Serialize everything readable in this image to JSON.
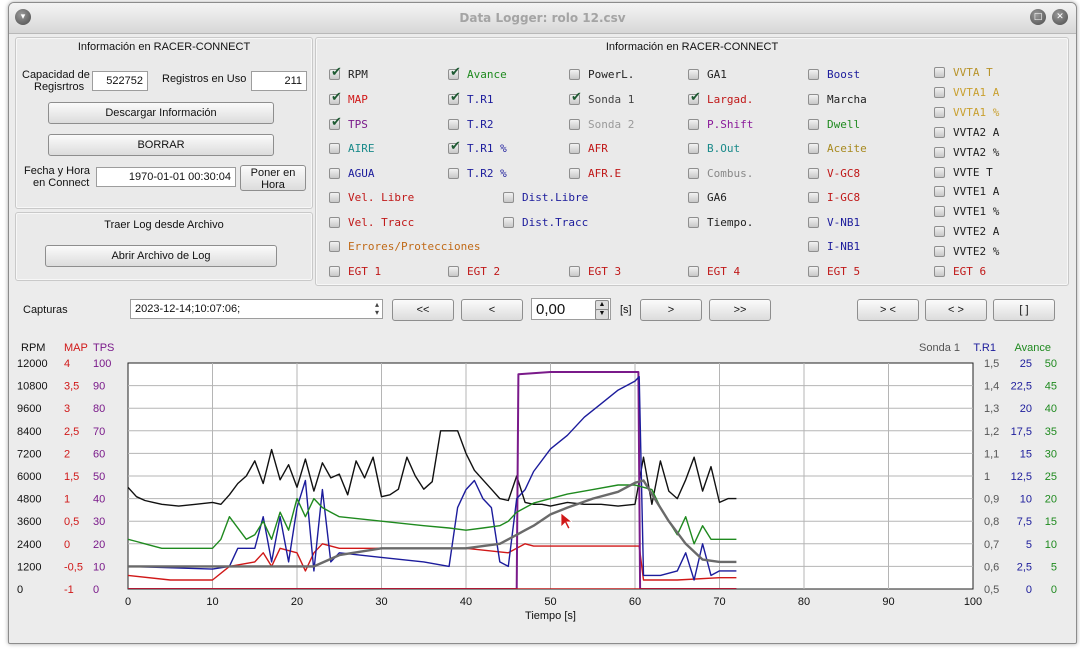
{
  "window": {
    "title": "Data Logger: rolo 12.csv"
  },
  "left_info": {
    "title": "Información en RACER-CONNECT",
    "capacity_label_1": "Capacidad de",
    "capacity_label_2": "Regisrtros",
    "capacity_value": "522752",
    "used_label": "Registros en Uso",
    "used_value": "211",
    "download_label": "Descargar Información",
    "erase_label": "BORRAR",
    "datetime_label_1": "Fecha y Hora",
    "datetime_label_2": "en Connect",
    "datetime_value": "1970-01-01 00:30:04",
    "set_time_label_1": "Poner en",
    "set_time_label_2": "Hora"
  },
  "file_group": {
    "title": "Traer Log desde Archivo",
    "open_label": "Abrir Archivo de Log"
  },
  "channels": {
    "title": "Información en RACER-CONNECT",
    "items": [
      {
        "label": "RPM",
        "checked": true,
        "color": "#222222"
      },
      {
        "label": "Avance",
        "checked": true,
        "color": "#1f8a1f"
      },
      {
        "label": "PowerL.",
        "checked": false,
        "color": "#222222"
      },
      {
        "label": "GA1",
        "checked": false,
        "color": "#222222"
      },
      {
        "label": "Boost",
        "checked": false,
        "color": "#1c1c9c"
      },
      {
        "label": "VVTA   T",
        "checked": false,
        "color": "#b8932a"
      },
      {
        "label": "MAP",
        "checked": true,
        "color": "#d01818"
      },
      {
        "label": "T.R1",
        "checked": true,
        "color": "#1c1c9c"
      },
      {
        "label": "Sonda 1",
        "checked": true,
        "color": "#444444"
      },
      {
        "label": "Largad.",
        "checked": true,
        "color": "#c01818"
      },
      {
        "label": "Marcha",
        "checked": false,
        "color": "#222222"
      },
      {
        "label": "VVTA1 A",
        "checked": false,
        "color": "#c9a030"
      },
      {
        "label": "TPS",
        "checked": true,
        "color": "#7a1a8a"
      },
      {
        "label": "T.R2",
        "checked": false,
        "color": "#1c1c9c"
      },
      {
        "label": "Sonda 2",
        "checked": false,
        "color": "#9a9a9a"
      },
      {
        "label": "P.Shift",
        "checked": false,
        "color": "#8a1a9a"
      },
      {
        "label": "Dwell",
        "checked": false,
        "color": "#1f8a1f"
      },
      {
        "label": "VVTA1 %",
        "checked": false,
        "color": "#c9a030"
      },
      {
        "label": "AIRE",
        "checked": false,
        "color": "#1a8a8a"
      },
      {
        "label": "T.R1 %",
        "checked": true,
        "color": "#1c1c9c"
      },
      {
        "label": "AFR",
        "checked": false,
        "color": "#c01818"
      },
      {
        "label": "B.Out",
        "checked": false,
        "color": "#1a8a8a"
      },
      {
        "label": "Aceite",
        "checked": false,
        "color": "#a88a20"
      },
      {
        "label": "VVTA2 A",
        "checked": false,
        "color": "#222222"
      },
      {
        "label": "AGUA",
        "checked": false,
        "color": "#1c1c9c"
      },
      {
        "label": "T.R2 %",
        "checked": false,
        "color": "#1c1c9c"
      },
      {
        "label": "AFR.E",
        "checked": false,
        "color": "#c01818"
      },
      {
        "label": "Combus.",
        "checked": false,
        "color": "#888888"
      },
      {
        "label": "V-GC8",
        "checked": false,
        "color": "#c01818"
      },
      {
        "label": "VVTA2 %",
        "checked": false,
        "color": "#222222"
      },
      {
        "label": "Vel. Libre",
        "checked": false,
        "color": "#c01818"
      },
      {
        "label": "Dist.Libre",
        "checked": false,
        "color": "#1c1c9c"
      },
      {
        "label": "GA6",
        "checked": false,
        "color": "#222222"
      },
      {
        "label": "I-GC8",
        "checked": false,
        "color": "#c01818"
      },
      {
        "label": "VVTE   T",
        "checked": false,
        "color": "#222222"
      },
      {
        "label": "Vel. Tracc",
        "checked": false,
        "color": "#c01818"
      },
      {
        "label": "Dist.Tracc",
        "checked": false,
        "color": "#1c1c9c"
      },
      {
        "label": "Tiempo.",
        "checked": false,
        "color": "#222222"
      },
      {
        "label": "V-NB1",
        "checked": false,
        "color": "#1c1c9c"
      },
      {
        "label": "VVTE1 A",
        "checked": false,
        "color": "#222222"
      },
      {
        "label": "Errores/Protecciones",
        "checked": false,
        "color": "#c06a18"
      },
      {
        "label": "I-NB1",
        "checked": false,
        "color": "#1c1c9c"
      },
      {
        "label": "VVTE1 %",
        "checked": false,
        "color": "#222222"
      },
      {
        "label": "VVTE2 A",
        "checked": false,
        "color": "#222222"
      },
      {
        "label": "VVTE2 %",
        "checked": false,
        "color": "#222222"
      },
      {
        "label": "EGT 1",
        "checked": false,
        "color": "#c01818"
      },
      {
        "label": "EGT 2",
        "checked": false,
        "color": "#c01818"
      },
      {
        "label": "EGT 3",
        "checked": false,
        "color": "#c01818"
      },
      {
        "label": "EGT 4",
        "checked": false,
        "color": "#c01818"
      },
      {
        "label": "EGT 5",
        "checked": false,
        "color": "#c01818"
      },
      {
        "label": "EGT 6",
        "checked": false,
        "color": "#c01818"
      }
    ]
  },
  "captures": {
    "label": "Capturas",
    "selected": "2023-12-14;10:07:06;",
    "first_label": "<<",
    "prev_label": "<",
    "offset_value": "0,00",
    "unit_label": "[s]",
    "next_label": ">",
    "last_label": ">>",
    "zoom_in_label": "> <",
    "zoom_out_label": "< >",
    "fit_label": "[ ]"
  },
  "chart_data": {
    "type": "line",
    "xlabel": "Tiempo [s]",
    "xlim": [
      0,
      100
    ],
    "x_ticks": [
      "0",
      "10",
      "20",
      "30",
      "40",
      "50",
      "60",
      "70",
      "80",
      "90",
      "100"
    ],
    "left_axes": [
      {
        "name": "RPM",
        "color": "#111111",
        "ticks": [
          "12000",
          "10800",
          "9600",
          "8400",
          "7200",
          "6000",
          "4800",
          "3600",
          "2400",
          "1200",
          "0"
        ]
      },
      {
        "name": "MAP",
        "color": "#d01818",
        "ticks": [
          "4",
          "3,5",
          "3",
          "2,5",
          "2",
          "1,5",
          "1",
          "0,5",
          "0",
          "-0,5",
          "-1"
        ]
      },
      {
        "name": "TPS",
        "color": "#7a1a8a",
        "ticks": [
          "100",
          "90",
          "80",
          "70",
          "60",
          "50",
          "40",
          "30",
          "20",
          "10",
          "0"
        ]
      }
    ],
    "right_axes": [
      {
        "name": "Sonda 1",
        "color": "#555555",
        "ticks": [
          "1,5",
          "1,4",
          "1,3",
          "1,2",
          "1,1",
          "1",
          "0,9",
          "0,8",
          "0,7",
          "0,6",
          "0,5"
        ]
      },
      {
        "name": "T.R1",
        "color": "#1c1c9c",
        "ticks": [
          "25",
          "22,5",
          "20",
          "17,5",
          "15",
          "12,5",
          "10",
          "7,5",
          "5",
          "2,5",
          "0"
        ]
      },
      {
        "name": "Avance",
        "color": "#1f8a1f",
        "ticks": [
          "50",
          "45",
          "40",
          "35",
          "30",
          "25",
          "20",
          "15",
          "10",
          "5",
          "0"
        ]
      }
    ],
    "series": [
      {
        "name": "RPM",
        "color": "#111111",
        "x": [
          0,
          1,
          2,
          3,
          4,
          6,
          8,
          10,
          11,
          12,
          13,
          14,
          15,
          16,
          17,
          18,
          19,
          20,
          21,
          22,
          23,
          24,
          25,
          26,
          27,
          28,
          29,
          30,
          31,
          32,
          33,
          34,
          35,
          36,
          37,
          38,
          39,
          40,
          41,
          42,
          43,
          44,
          45,
          46,
          47,
          48,
          49,
          50,
          52,
          54,
          56,
          58,
          60,
          61,
          62,
          63,
          64,
          65,
          66,
          67,
          68,
          69,
          70,
          71,
          72
        ],
        "y": [
          5400,
          4900,
          4700,
          4600,
          4500,
          4400,
          4500,
          4600,
          4500,
          5000,
          5600,
          6000,
          6800,
          5600,
          7400,
          5800,
          6600,
          5400,
          6900,
          5200,
          6700,
          5900,
          6100,
          5000,
          6800,
          5900,
          7000,
          4900,
          5000,
          5300,
          7000,
          6000,
          5300,
          5700,
          8400,
          8400,
          8400,
          7200,
          6300,
          5800,
          5300,
          4800,
          4700,
          6000,
          4600,
          4500,
          4500,
          4400,
          4600,
          4500,
          4500,
          4400,
          4500,
          7000,
          4500,
          6800,
          5200,
          4800,
          5800,
          7000,
          5200,
          6500,
          4600,
          4800,
          4800
        ]
      },
      {
        "name": "MAP",
        "color": "#d01818",
        "x": [
          0,
          5,
          10,
          12,
          15,
          16,
          17,
          18,
          20,
          21,
          22,
          23,
          25,
          30,
          35,
          40,
          45,
          46,
          47,
          48,
          50,
          55,
          60,
          60.5,
          61,
          65,
          70,
          72
        ],
        "y": [
          -0.7,
          -0.8,
          -0.8,
          -0.5,
          -0.4,
          -0.2,
          -0.5,
          -0.1,
          -0.2,
          -0.6,
          -0.2,
          0.0,
          -0.1,
          -0.1,
          -0.1,
          -0.1,
          -0.2,
          -0.1,
          0.0,
          -0.05,
          -0.05,
          -0.05,
          -0.05,
          -0.05,
          -0.8,
          -0.8,
          -0.75,
          -0.75
        ]
      },
      {
        "name": "TPS",
        "color": "#7a1a8a",
        "x": [
          0,
          46,
          46.2,
          50,
          60,
          60.4,
          60.6,
          72
        ],
        "y": [
          0,
          0,
          95,
          96,
          96,
          96,
          0,
          0
        ]
      },
      {
        "name": "T.R1",
        "color": "#1c1c9c",
        "x": [
          0,
          10,
          12,
          13,
          15,
          16,
          17,
          18,
          19,
          20,
          21,
          22,
          23,
          24,
          25,
          30,
          35,
          38,
          39,
          40,
          41,
          42,
          43,
          44,
          45,
          46,
          47,
          48,
          50,
          52,
          54,
          56,
          58,
          60,
          60.5,
          61,
          63,
          65,
          66,
          67,
          68,
          69,
          70,
          72
        ],
        "y": [
          2.5,
          2.2,
          2.5,
          4.5,
          4.5,
          8.0,
          3.0,
          8.0,
          3.0,
          9.0,
          12.0,
          2.0,
          11.0,
          3.0,
          4.0,
          3.5,
          3.0,
          2.5,
          9.0,
          11.0,
          12.0,
          10.0,
          9.0,
          3.0,
          2.5,
          10.0,
          11.0,
          13.0,
          15.5,
          17.0,
          19.0,
          20.5,
          22.0,
          23.0,
          23.5,
          1.5,
          1.5,
          2.0,
          4.0,
          1.0,
          5.0,
          1.5,
          2.0,
          2.0
        ]
      },
      {
        "name": "Avance",
        "color": "#1f8a1f",
        "x": [
          0,
          1,
          2,
          3,
          4,
          10,
          11,
          12,
          14,
          15,
          16,
          17,
          18,
          19,
          20,
          21,
          22,
          23,
          24,
          25,
          30,
          35,
          38,
          40,
          42,
          44,
          45,
          46,
          48,
          50,
          52,
          55,
          58,
          60,
          62,
          63,
          64,
          65,
          66,
          67,
          68,
          69,
          70,
          72
        ],
        "y": [
          11,
          10.5,
          10,
          9.5,
          9,
          9,
          11,
          16,
          11,
          12,
          15,
          11,
          17,
          13,
          20,
          16,
          20,
          18,
          17,
          16,
          15,
          14,
          13.5,
          13,
          13.5,
          14,
          15,
          17,
          19,
          20,
          21,
          22,
          23,
          23,
          22,
          18,
          15,
          12,
          16,
          10,
          14,
          11,
          11,
          11
        ]
      },
      {
        "name": "Sonda 1",
        "color": "#6a6a6a",
        "x": [
          0,
          10,
          20,
          22,
          25,
          30,
          35,
          40,
          44,
          45,
          46,
          47,
          48,
          50,
          52,
          55,
          58,
          60,
          61,
          62,
          64,
          66,
          68,
          70,
          72
        ],
        "y": [
          0.6,
          0.6,
          0.6,
          0.6,
          0.65,
          0.68,
          0.68,
          0.68,
          0.7,
          0.72,
          0.74,
          0.76,
          0.78,
          0.83,
          0.86,
          0.9,
          0.93,
          0.97,
          0.98,
          0.92,
          0.8,
          0.7,
          0.63,
          0.62,
          0.62
        ]
      },
      {
        "name": "Largad.",
        "color": "#c01818",
        "x": [
          0,
          46,
          46.1,
          60.5,
          60.6,
          72
        ],
        "y": [
          0,
          0,
          0,
          0,
          0,
          0
        ]
      }
    ]
  }
}
